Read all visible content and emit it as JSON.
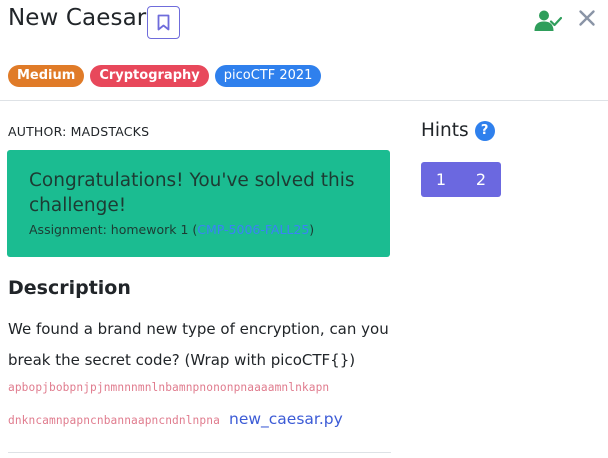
{
  "challenge": {
    "title": "New Caesar",
    "tags": [
      {
        "label": "Medium",
        "color": "#e07b28"
      },
      {
        "label": "Cryptography",
        "color": "#e8485b"
      },
      {
        "label": "picoCTF 2021",
        "color": "#2f80ed"
      }
    ]
  },
  "icons": {
    "bookmark": "bookmark-icon",
    "solved": "user-check-icon",
    "close": "close-icon",
    "help": "question-icon"
  },
  "colors": {
    "accent": "#6b68e0",
    "success_bg": "#1bbc91",
    "solved_icon": "#2f9e5b"
  },
  "author": "AUTHOR: MADSTACKS",
  "banner": {
    "message": "Congratulations! You've solved this challenge!",
    "assignment_prefix": "Assignment: homework 1 (",
    "assignment_code": "CMP-5006-FALL25",
    "assignment_suffix": ")"
  },
  "description": {
    "heading": "Description",
    "text": "We found a brand new type of encryption, can you break the secret code? (Wrap with picoCTF{})",
    "ciphertext_line1": "apbopjbobpnjpjnmnnnmnlnbamnpnononpnaaaamnlnkapn",
    "ciphertext_line2": "dnkncamnpapncnbannaapncndnlnpna",
    "file_link": "new_caesar.py"
  },
  "hints": {
    "heading": "Hints",
    "help_glyph": "?",
    "buttons": [
      "1",
      "2"
    ]
  }
}
